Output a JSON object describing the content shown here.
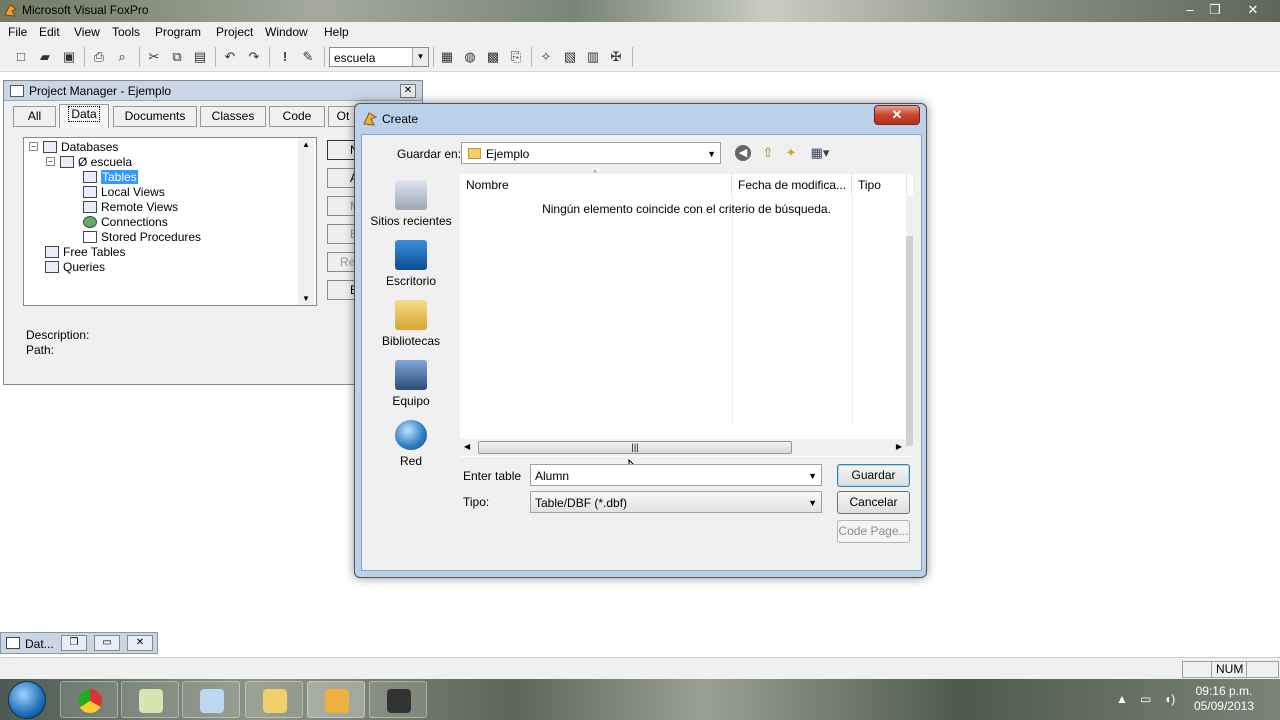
{
  "app": {
    "title": "Microsoft Visual FoxPro",
    "window_controls": [
      "–",
      "❐",
      "✕"
    ],
    "menu": [
      "File",
      "Edit",
      "View",
      "Tools",
      "Program",
      "Project",
      "Window",
      "Help"
    ],
    "toolbar": {
      "database_combo_value": "escuela"
    }
  },
  "project_manager": {
    "title": "Project Manager - Ejemplo",
    "tabs": [
      "All",
      "Data",
      "Documents",
      "Classes",
      "Code",
      "Ot"
    ],
    "active_tab": "Data",
    "tree": {
      "databases": "Databases",
      "db_name": "Ø escuela",
      "tables": "Tables",
      "local_views": "Local Views",
      "remote_views": "Remote Views",
      "connections": "Connections",
      "stored_procedures": "Stored Procedures",
      "free_tables": "Free Tables",
      "queries": "Queries"
    },
    "buttons": [
      "N",
      "A",
      "M",
      "B",
      "Re",
      "B"
    ],
    "description_label": "Description:",
    "path_label": "Path:"
  },
  "minimized_window": {
    "title": "Dat...",
    "controls": [
      "❐",
      "▭",
      "✕"
    ]
  },
  "statusbar": {
    "num": "NUM"
  },
  "create_dialog": {
    "title": "Create",
    "save_in_label": "Guardar en:",
    "save_in_value": "Ejemplo",
    "places": [
      "Sitios recientes",
      "Escritorio",
      "Bibliotecas",
      "Equipo",
      "Red"
    ],
    "columns": [
      "Nombre",
      "Fecha de modifica...",
      "Tipo"
    ],
    "empty_message": "Ningún elemento coincide con el criterio de búsqueda.",
    "enter_table_label": "Enter table",
    "enter_table_value": "Alumn",
    "type_label": "Tipo:",
    "type_value": "Table/DBF (*.dbf)",
    "save_button": "Guardar",
    "cancel_button": "Cancelar",
    "code_page_button": "Code Page..."
  },
  "taskbar": {
    "time": "09:16 p.m.",
    "date": "05/09/2013"
  }
}
